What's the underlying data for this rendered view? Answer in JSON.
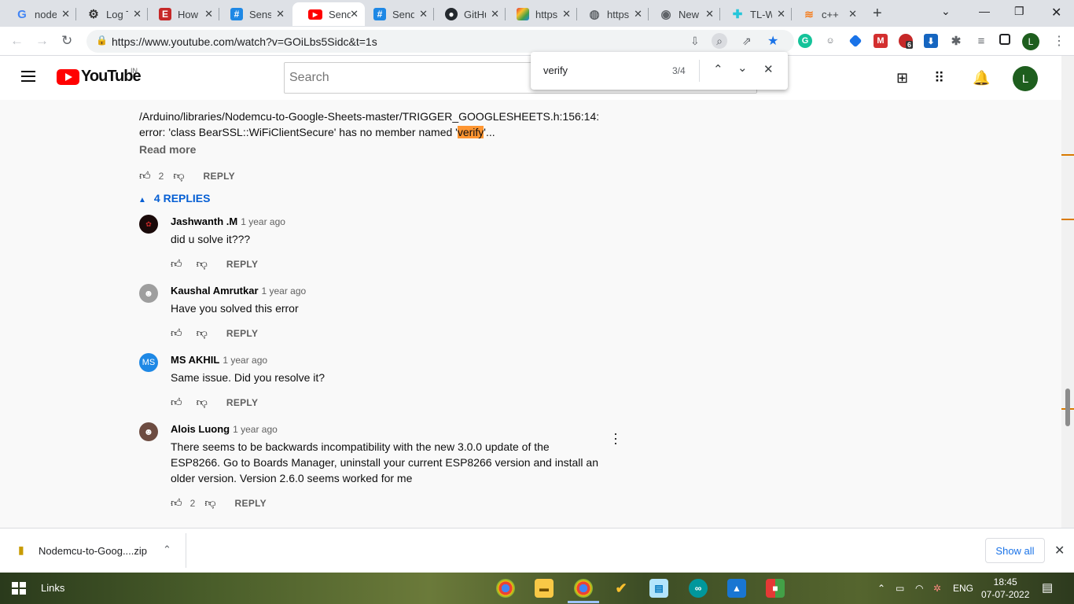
{
  "browser": {
    "tabs": [
      {
        "title": "node",
        "icon": "google-icon"
      },
      {
        "title": "Log T",
        "icon": "gear-icon"
      },
      {
        "title": "How",
        "icon": "e-icon"
      },
      {
        "title": "Sens",
        "icon": "hash-icon"
      },
      {
        "title": "Send",
        "icon": "youtube-icon"
      },
      {
        "title": "Send",
        "icon": "hash-icon"
      },
      {
        "title": "GitHu",
        "icon": "github-icon"
      },
      {
        "title": "https",
        "icon": "site-icon"
      },
      {
        "title": "https",
        "icon": "globe-icon"
      },
      {
        "title": "New",
        "icon": "chrome-icon"
      },
      {
        "title": "TL-W",
        "icon": "tplink-icon"
      },
      {
        "title": "c++",
        "icon": "stackoverflow-icon"
      }
    ],
    "active_tab": 4,
    "url": "https://www.youtube.com/watch?v=GOiLbs5Sidc&t=1s",
    "profile_initial": "L",
    "extension_badge": "6"
  },
  "find_bar": {
    "query": "verify",
    "count": "3/4"
  },
  "youtube": {
    "search_placeholder": "Search",
    "country_code": "IN",
    "logo_text": "YouTube",
    "avatar_initial": "L"
  },
  "comment": {
    "line1": "/Arduino/libraries/Nodemcu-to-Google-Sheets-master/TRIGGER_GOOGLESHEETS.h:156:14:",
    "line2_before": "error: 'class BearSSL::WiFiClientSecure' has no member named '",
    "line2_match": "verify",
    "line2_after": "'...",
    "read_more": "Read more",
    "likes": "2",
    "reply_label": "REPLY",
    "replies_toggle": "4 REPLIES"
  },
  "replies": [
    {
      "author": "Jashwanth .M",
      "time": "1 year ago",
      "text": [
        "did u solve it???"
      ],
      "likes": "",
      "reply_label": "REPLY",
      "avatar": ""
    },
    {
      "author": "Kaushal Amrutkar",
      "time": "1 year ago",
      "text": [
        "Have you solved this error"
      ],
      "likes": "",
      "reply_label": "REPLY",
      "avatar": ""
    },
    {
      "author": "MS AKHIL",
      "time": "1 year ago",
      "text": [
        "Same issue. Did you resolve it?"
      ],
      "likes": "",
      "reply_label": "REPLY",
      "avatar": "MS"
    },
    {
      "author": "Alois Luong",
      "time": "1 year ago",
      "text": [
        "There seems to be backwards incompatibility with the new 3.0.0 update of the",
        "ESP8266. Go to Boards Manager, uninstall your current ESP8266 version and install an",
        "older version. Version 2.6.0 seems worked for me"
      ],
      "likes": "2",
      "reply_label": "REPLY",
      "avatar": ""
    }
  ],
  "download": {
    "filename": "Nodemcu-to-Goog....zip",
    "show_all": "Show all"
  },
  "taskbar": {
    "links_label": "Links",
    "lang": "ENG",
    "time": "18:45",
    "date": "07-07-2022"
  }
}
